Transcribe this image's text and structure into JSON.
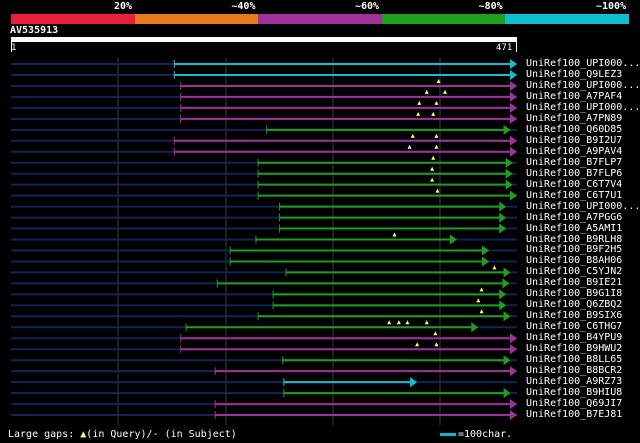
{
  "legend": {
    "labels": [
      "20%",
      "~40%",
      "~60%",
      "~80%",
      "~100%"
    ],
    "colors": [
      "#e8203a",
      "#e87a1e",
      "#a0309a",
      "#1ea01e",
      "#10c0d0"
    ]
  },
  "query": {
    "id": "AV535913",
    "start": "1",
    "end": "471",
    "length": 471
  },
  "hits": [
    {
      "label": "UniRef100_UPI000...",
      "start": 152,
      "end": 471,
      "color": "cyan",
      "lead": 0,
      "gaps": []
    },
    {
      "label": "UniRef100_Q9LEZ3",
      "start": 152,
      "end": 471,
      "color": "cyan",
      "lead": 0,
      "gaps": []
    },
    {
      "label": "UniRef100_UPI000...",
      "start": 158,
      "end": 471,
      "color": "magenta",
      "lead": 0,
      "gaps": [
        398
      ]
    },
    {
      "label": "UniRef100_A7PAF4",
      "start": 158,
      "end": 471,
      "color": "magenta",
      "lead": 0,
      "gaps": [
        387,
        404
      ]
    },
    {
      "label": "UniRef100_UPI000...",
      "start": 158,
      "end": 471,
      "color": "magenta",
      "lead": 0,
      "gaps": [
        380,
        396
      ]
    },
    {
      "label": "UniRef100_A7PN89",
      "start": 158,
      "end": 471,
      "color": "magenta",
      "lead": 0,
      "gaps": [
        379,
        393
      ]
    },
    {
      "label": "UniRef100_Q60D85",
      "start": 238,
      "end": 465,
      "color": "green",
      "lead": 0,
      "gaps": []
    },
    {
      "label": "UniRef100_B9I2U7",
      "start": 152,
      "end": 471,
      "color": "magenta",
      "lead": 0,
      "gaps": [
        374,
        396
      ]
    },
    {
      "label": "UniRef100_A9PAV4",
      "start": 152,
      "end": 471,
      "color": "magenta",
      "lead": 0,
      "gaps": [
        371,
        396
      ]
    },
    {
      "label": "UniRef100_B7FLP7",
      "start": 230,
      "end": 467,
      "color": "green",
      "lead": 0,
      "gaps": [
        393
      ]
    },
    {
      "label": "UniRef100_B7FLP6",
      "start": 230,
      "end": 467,
      "color": "green",
      "lead": 0,
      "gaps": [
        392
      ]
    },
    {
      "label": "UniRef100_C6T7V4",
      "start": 230,
      "end": 467,
      "color": "green",
      "lead": 0,
      "gaps": [
        392
      ]
    },
    {
      "label": "UniRef100_C6T7U1",
      "start": 230,
      "end": 471,
      "color": "green",
      "lead": 0,
      "gaps": [
        397
      ]
    },
    {
      "label": "UniRef100_UPI000...",
      "start": 250,
      "end": 461,
      "color": "green",
      "lead": 0,
      "gaps": []
    },
    {
      "label": "UniRef100_A7PGG6",
      "start": 250,
      "end": 461,
      "color": "green",
      "lead": 0,
      "gaps": []
    },
    {
      "label": "UniRef100_A5AMI1",
      "start": 250,
      "end": 461,
      "color": "green",
      "lead": 0,
      "gaps": []
    },
    {
      "label": "UniRef100_B9RLH8",
      "start": 228,
      "end": 415,
      "color": "green",
      "lead": 0,
      "gaps": [
        357
      ]
    },
    {
      "label": "UniRef100_B9F2H5",
      "start": 204,
      "end": 445,
      "color": "green",
      "lead": 0,
      "gaps": []
    },
    {
      "label": "UniRef100_B8AH06",
      "start": 204,
      "end": 445,
      "color": "green",
      "lead": 0,
      "gaps": []
    },
    {
      "label": "UniRef100_C5YJN2",
      "start": 256,
      "end": 465,
      "color": "green",
      "lead": 0,
      "gaps": [
        450
      ]
    },
    {
      "label": "UniRef100_B9IE21",
      "start": 192,
      "end": 464,
      "color": "green",
      "lead": 0,
      "gaps": []
    },
    {
      "label": "UniRef100_B9G1I8",
      "start": 244,
      "end": 461,
      "color": "green",
      "lead": 0,
      "gaps": [
        438
      ]
    },
    {
      "label": "UniRef100_Q6ZBQ2",
      "start": 244,
      "end": 461,
      "color": "green",
      "lead": 0,
      "gaps": [
        435
      ]
    },
    {
      "label": "UniRef100_B9SIX6",
      "start": 230,
      "end": 465,
      "color": "green",
      "lead": 0,
      "gaps": [
        438
      ]
    },
    {
      "label": "UniRef100_C6THG7",
      "start": 163,
      "end": 435,
      "color": "green",
      "lead": 0,
      "gaps": [
        352,
        361,
        369,
        387
      ]
    },
    {
      "label": "UniRef100_B4YPU9",
      "start": 158,
      "end": 471,
      "color": "magenta",
      "lead": 0,
      "gaps": [
        395
      ]
    },
    {
      "label": "UniRef100_B9HWU2",
      "start": 158,
      "end": 471,
      "color": "magenta",
      "lead": 0,
      "gaps": [
        378,
        396
      ]
    },
    {
      "label": "UniRef100_B8LL65",
      "start": 253,
      "end": 465,
      "color": "green",
      "lead": 0,
      "gaps": []
    },
    {
      "label": "UniRef100_B8BCR2",
      "start": 190,
      "end": 471,
      "color": "magenta",
      "lead": 0,
      "gaps": []
    },
    {
      "label": "UniRef100_A9RZ73",
      "start": 254,
      "end": 378,
      "color": "cyan",
      "lead": 0,
      "gaps": []
    },
    {
      "label": "UniRef100_B9HIU8",
      "start": 254,
      "end": 465,
      "color": "green",
      "lead": 0,
      "gaps": []
    },
    {
      "label": "UniRef100_Q69JI7",
      "start": 190,
      "end": 471,
      "color": "magenta",
      "lead": 0,
      "gaps": []
    },
    {
      "label": "UniRef100_B7EJ81",
      "start": 190,
      "end": 471,
      "color": "magenta",
      "lead": 0,
      "gaps": []
    }
  ],
  "footer": {
    "large_gaps": "Large gaps:",
    "in_query": "(in Query)/",
    "in_subject": "- (in Subject)",
    "scale": "=100char."
  }
}
